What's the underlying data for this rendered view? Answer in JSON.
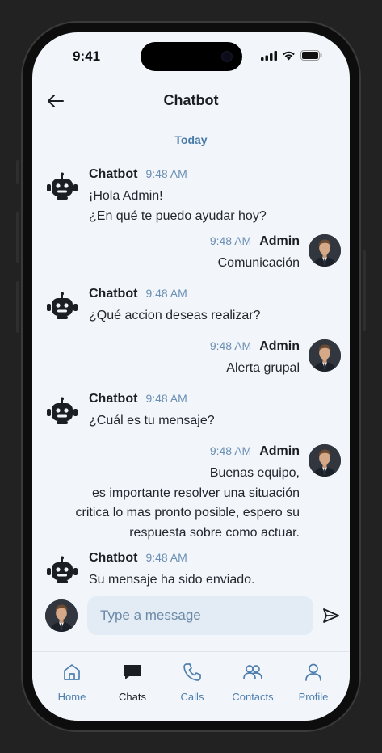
{
  "status_bar": {
    "time": "9:41"
  },
  "header": {
    "title": "Chatbot",
    "back_icon": "arrow-left-icon"
  },
  "day_separator": "Today",
  "messages": [
    {
      "sender": "Chatbot",
      "time": "9:48 AM",
      "lines": [
        "¡Hola Admin!",
        "¿En qué te puedo ayudar hoy?"
      ]
    },
    {
      "sender": "Admin",
      "time": "9:48 AM",
      "lines": [
        "Comunicación"
      ]
    },
    {
      "sender": "Chatbot",
      "time": "9:48 AM",
      "lines": [
        "¿Qué accion deseas realizar?"
      ]
    },
    {
      "sender": "Admin",
      "time": "9:48 AM",
      "lines": [
        "Alerta grupal"
      ]
    },
    {
      "sender": "Chatbot",
      "time": "9:48 AM",
      "lines": [
        "¿Cuál es tu mensaje?"
      ]
    },
    {
      "sender": "Admin",
      "time": "9:48 AM",
      "lines": [
        "Buenas equipo,",
        "es importante resolver una situación",
        "critica lo mas pronto posible, espero su",
        "respuesta sobre como actuar."
      ]
    },
    {
      "sender": "Chatbot",
      "time": "9:48 AM",
      "lines": [
        "Su mensaje ha sido enviado."
      ]
    }
  ],
  "composer": {
    "placeholder": "Type a message",
    "send_icon": "send-icon"
  },
  "tabs": [
    {
      "label": "Home",
      "icon": "home-icon",
      "active": false
    },
    {
      "label": "Chats",
      "icon": "chat-icon",
      "active": true
    },
    {
      "label": "Calls",
      "icon": "phone-icon",
      "active": false
    },
    {
      "label": "Contacts",
      "icon": "contacts-icon",
      "active": false
    },
    {
      "label": "Profile",
      "icon": "profile-icon",
      "active": false
    }
  ],
  "colors": {
    "accent": "#4f7fae",
    "background": "#f2f6fb",
    "input": "#e3ebf4"
  }
}
